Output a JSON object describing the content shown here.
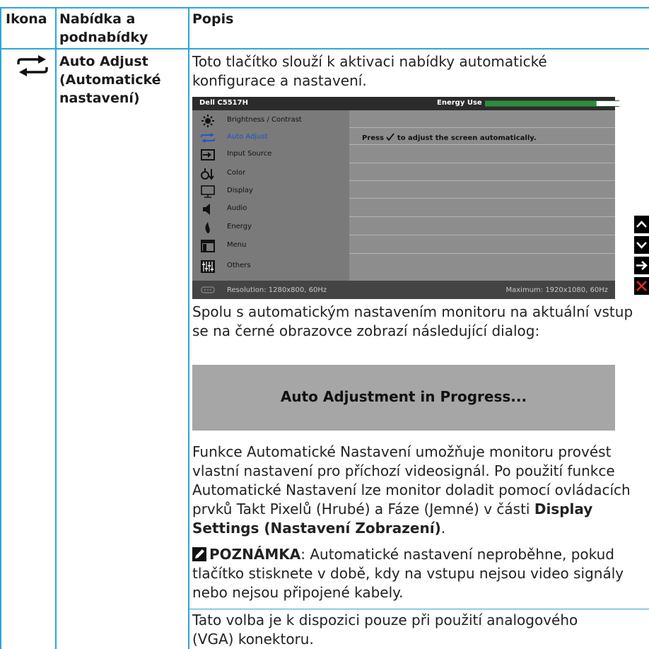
{
  "table": {
    "headers": [
      "Ikona",
      "Nabídka a podnabídky",
      "Popis"
    ],
    "menu_name": "Auto Adjust (Automatické nastavení)"
  },
  "description": {
    "intro": "Toto tlačítko slouží k aktivaci nabídky automatické konfigurace a nastavení.",
    "dialog_intro": "Spolu s automatickým nastavením monitoru na aktuální vstup se na černé obrazovce zobrazí následující dialog:",
    "dialog_text": "Auto Adjustment in Progress...",
    "para_pre": "Funkce Automatické Nastavení umožňuje monitoru provést vlastní nastavení pro příchozí videosignál. Po použití funkce Automatické Nastavení lze monitor doladit pomocí ovládacích prvků Takt Pixelů (Hrubé) a Fáze (Jemné) v části ",
    "para_bold": "Display Settings (Nastavení Zobrazení)",
    "para_post": ".",
    "note_label": "POZNÁMKA",
    "note_text": ": Automatické nastavení neproběhne, pokud tlačítko stisknete v době, kdy na vstupu nejsou video signály nebo nejsou připojené kabely.",
    "last": "Tato volba je k dispozici pouze při použití analogového (VGA) konektoru."
  },
  "osd": {
    "model": "Dell C5517H",
    "energy_label": "Energy Use",
    "energy_level": 0.83,
    "items": [
      {
        "icon": "brightness-icon",
        "label": "Brightness / Contrast"
      },
      {
        "icon": "auto-adjust-icon",
        "label": "Auto Adjust"
      },
      {
        "icon": "input-source-icon",
        "label": "Input Source"
      },
      {
        "icon": "color-icon",
        "label": "Color"
      },
      {
        "icon": "display-icon",
        "label": "Display"
      },
      {
        "icon": "audio-icon",
        "label": "Audio"
      },
      {
        "icon": "energy-icon",
        "label": "Energy"
      },
      {
        "icon": "menu-icon",
        "label": "Menu"
      },
      {
        "icon": "others-icon",
        "label": "Others"
      }
    ],
    "selected_index": 1,
    "message_prefix": "Press",
    "message_suffix": "to adjust the screen automatically.",
    "resolution": "Resolution: 1280x800, 60Hz",
    "maximum": "Maximum: 1920x1080, 60Hz"
  },
  "nav_buttons": [
    "up-arrow-icon",
    "down-arrow-icon",
    "right-arrow-icon",
    "close-icon"
  ],
  "colors": {
    "border": "#2aa7d8",
    "selected": "#1d53c6",
    "close": "#e22b2b"
  }
}
